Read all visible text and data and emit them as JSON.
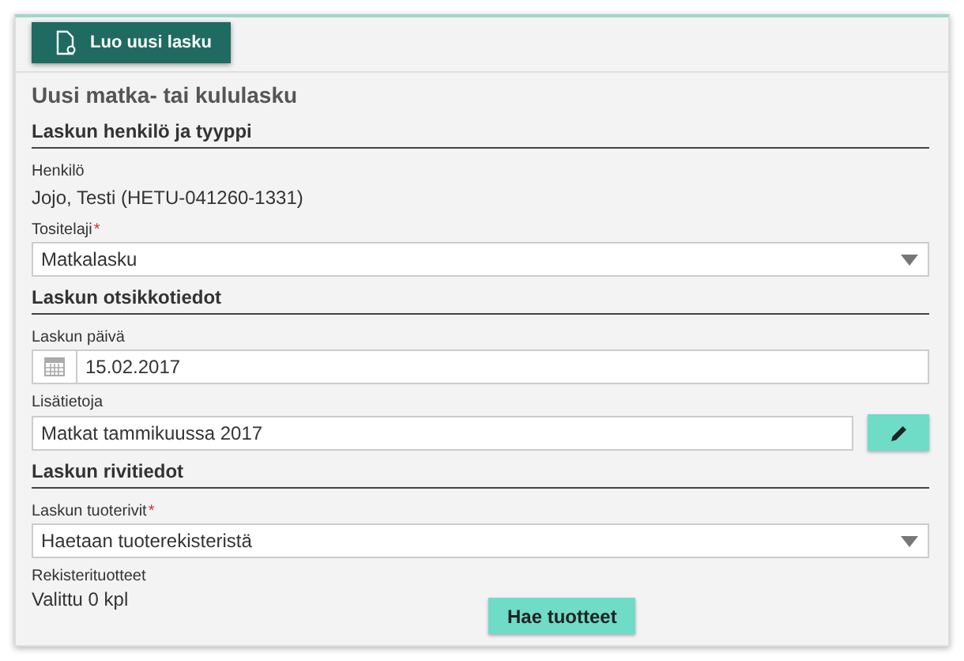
{
  "toolbar": {
    "new_button": "Luo uusi lasku"
  },
  "form": {
    "title": "Uusi matka- tai kululasku",
    "sections": [
      {
        "heading": "Laskun henkilö ja tyyppi",
        "fields": [
          {
            "kind": "static",
            "label": "Henkilö",
            "value": "Jojo, Testi (HETU-041260-1331)"
          },
          {
            "kind": "select",
            "label": "Tositelaji",
            "required_mark": "*",
            "value": "Matkalasku"
          }
        ]
      },
      {
        "heading": "Laskun otsikkotiedot",
        "fields": [
          {
            "kind": "date",
            "label": "Laskun päivä",
            "value": "15.02.2017"
          },
          {
            "kind": "edit",
            "label": "Lisätietoja",
            "value": "Matkat tammikuussa 2017"
          }
        ]
      },
      {
        "heading": "Laskun rivitiedot",
        "fields": [
          {
            "kind": "select",
            "label": "Laskun tuoterivit",
            "required_mark": "*",
            "value": "Haetaan tuoterekisteristä"
          },
          {
            "kind": "products",
            "label": "Rekisterituotteet",
            "value": "Valittu 0 kpl",
            "button": "Hae tuotteet"
          }
        ]
      }
    ]
  }
}
